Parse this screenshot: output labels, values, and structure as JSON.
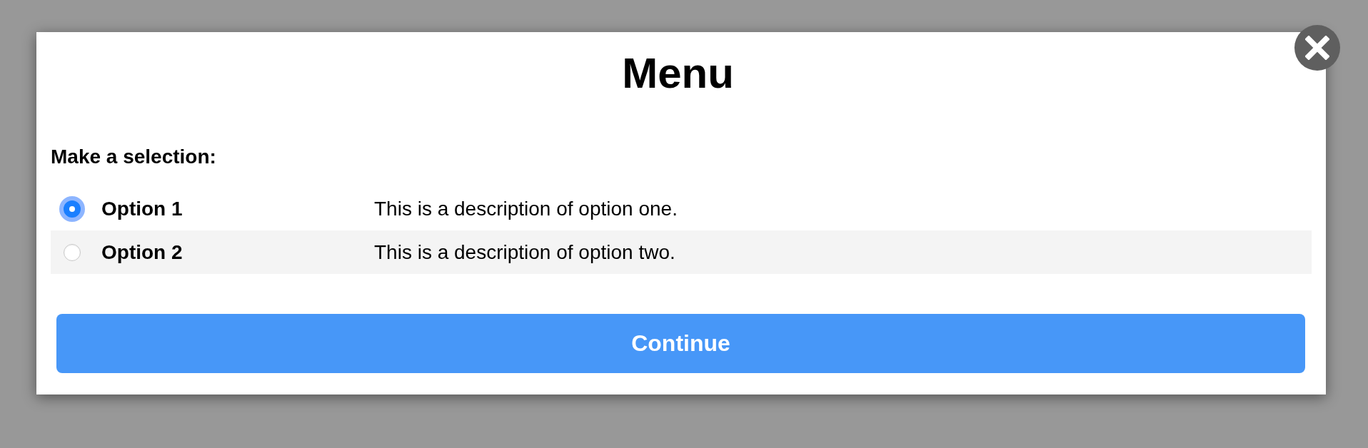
{
  "dialog": {
    "title": "Menu",
    "prompt": "Make a selection:",
    "options": [
      {
        "label": "Option 1",
        "description": "This is a description of option one.",
        "selected": true
      },
      {
        "label": "Option 2",
        "description": "This is a description of option two.",
        "selected": false
      }
    ],
    "button": "Continue"
  }
}
